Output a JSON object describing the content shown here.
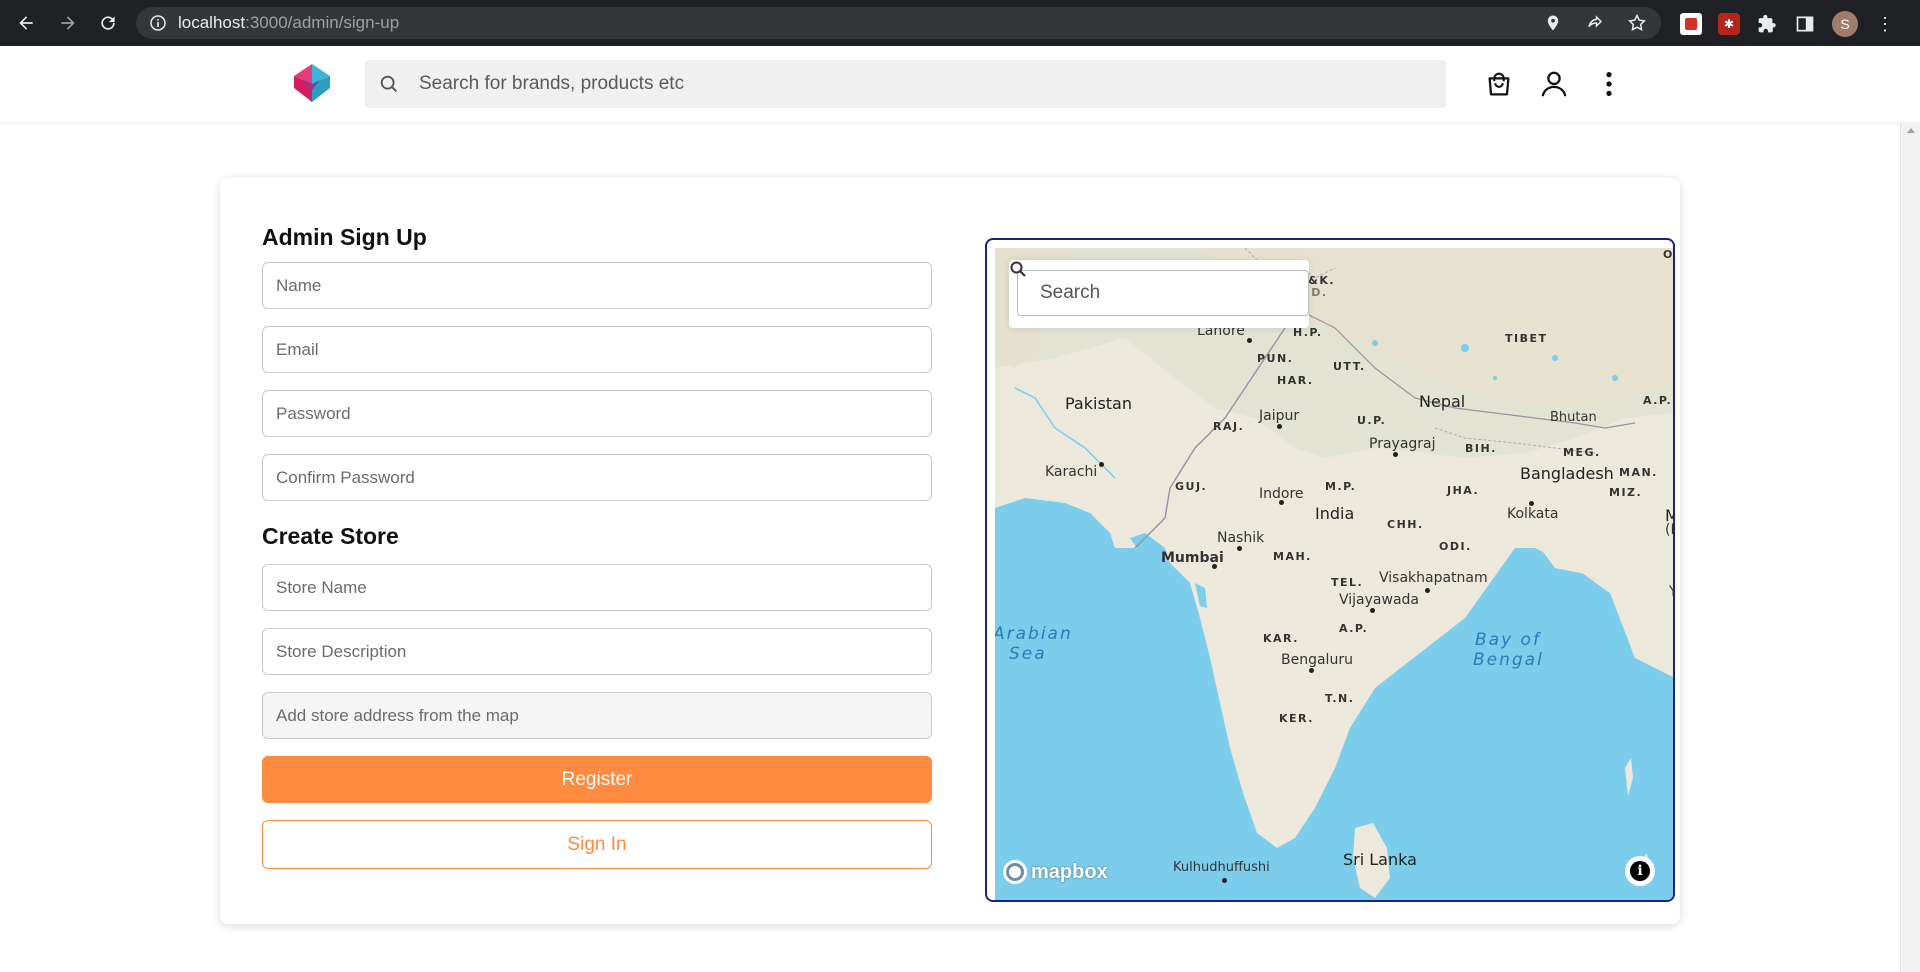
{
  "browser": {
    "url_host": "localhost",
    "url_path": ":3000/admin/sign-up",
    "profile_initial": "S"
  },
  "header": {
    "search_placeholder": "Search for brands, products etc"
  },
  "form": {
    "title": "Admin Sign Up",
    "name_placeholder": "Name",
    "email_placeholder": "Email",
    "password_placeholder": "Password",
    "confirm_password_placeholder": "Confirm Password",
    "store_section_title": "Create Store",
    "store_name_placeholder": "Store Name",
    "store_description_placeholder": "Store Description",
    "store_address_placeholder": "Add store address from the map",
    "register_label": "Register",
    "signin_label": "Sign In"
  },
  "map": {
    "search_placeholder": "Search",
    "attribution": "mapbox",
    "info_glyph": "i",
    "labels": {
      "pakistan": "Pakistan",
      "nepal": "Nepal",
      "tibet": "TIBET",
      "bhutan": "Bhutan",
      "india": "India",
      "bangladesh": "Bangladesh",
      "sri_lanka": "Sri Lanka",
      "lahore": "Lahore",
      "karachi": "Karachi",
      "jaipur": "Jaipur",
      "prayagraj": "Prayagraj",
      "indore": "Indore",
      "kolkata": "Kolkata",
      "nashik": "Nashik",
      "mumbai": "Mumbai",
      "visakhapatnam": "Visakhapatnam",
      "vijayawada": "Vijayawada",
      "bengaluru": "Bengaluru",
      "kulhudhuffushi": "Kulhudhuffushi",
      "hp": "H.P.",
      "pun": "PUN.",
      "utt": "UTT.",
      "har": "HAR.",
      "raj": "RAJ.",
      "up": "U.P.",
      "bih": "BIH.",
      "meg": "MEG.",
      "ap_ne": "A.P.",
      "man": "MAN.",
      "miz": "MIZ.",
      "guj": "GUJ.",
      "mp": "M.P.",
      "jha": "JHA.",
      "chh": "CHH.",
      "odi": "ODI.",
      "mah": "MAH.",
      "tel": "TEL.",
      "ap": "A.P.",
      "kar": "KAR.",
      "tn": "T.N.",
      "ker": "KER.",
      "jk": "J.&K.",
      "ld": "L.D.",
      "oi": "OI",
      "m": "M",
      "b": "(B",
      "y": "Y",
      "arabian_sea_1": "Arabian",
      "arabian_sea_2": "Sea",
      "bay_of_bengal_1": "Bay of",
      "bay_of_bengal_2": "Bengal"
    }
  }
}
